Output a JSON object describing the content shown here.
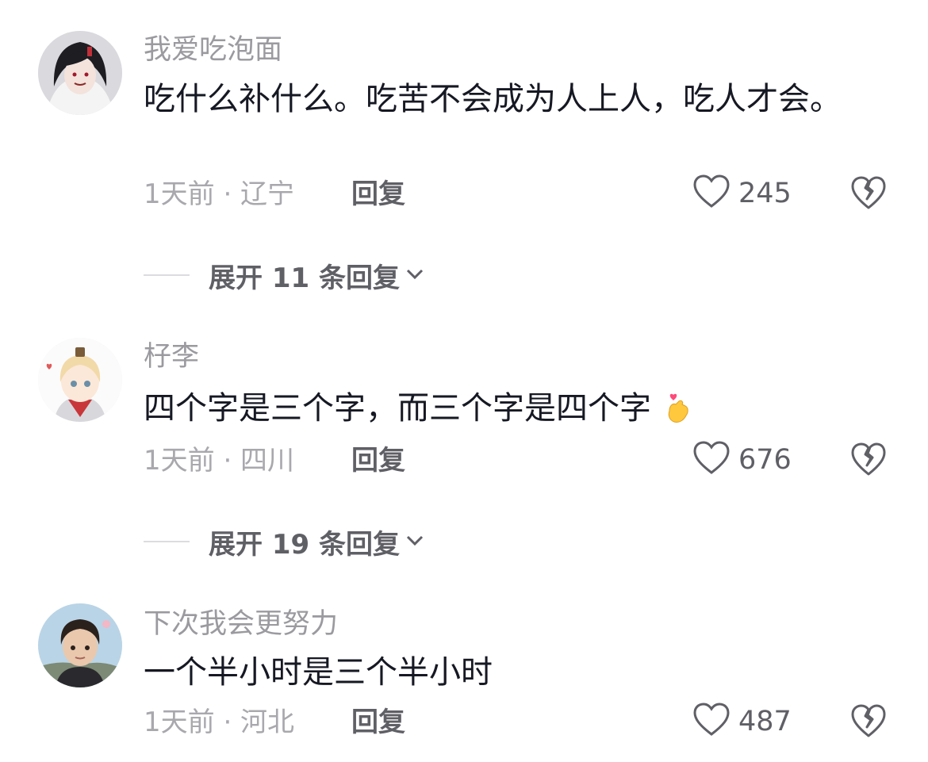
{
  "comments": [
    {
      "username": "我爱吃泡面",
      "text": "吃什么补什么。吃苦不会成为人上人，吃人才会。",
      "time_location": "1天前 · 辽宁",
      "reply_label": "回复",
      "likes": "245",
      "expand_label": "展开 11 条回复"
    },
    {
      "username": "杍李",
      "text": "四个字是三个字，而三个字是四个字",
      "emoji": "finger-heart-emoji",
      "time_location": "1天前 · 四川",
      "reply_label": "回复",
      "likes": "676",
      "expand_label": "展开 19 条回复"
    },
    {
      "username": "下次我会更努力",
      "text": "一个半小时是三个半小时",
      "time_location": "1天前 · 河北",
      "reply_label": "回复",
      "likes": "487"
    }
  ],
  "icons": {
    "like": "heart-outline-icon",
    "dislike": "broken-heart-icon",
    "expand": "chevron-down-icon"
  },
  "colors": {
    "text": "#161823",
    "muted": "#9a9a9f",
    "action": "#5f5f66"
  }
}
